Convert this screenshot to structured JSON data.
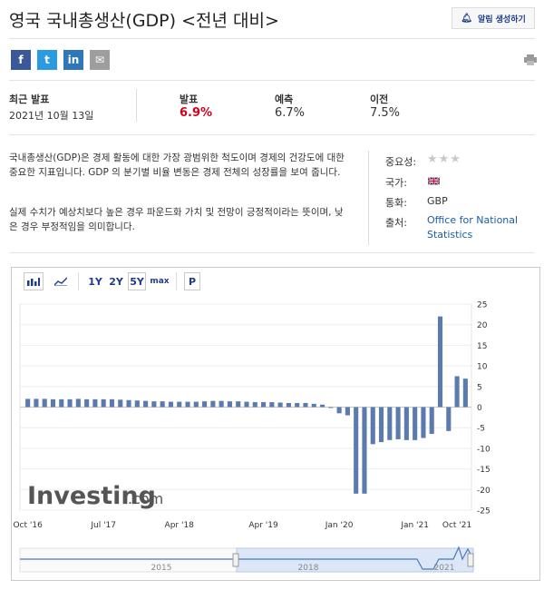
{
  "header": {
    "title": "영국 국내총생산(GDP) <전년 대비>",
    "alert_label": "알림 생성하기"
  },
  "share": [
    {
      "name": "facebook-button",
      "glyph": "f",
      "color": "#3b5998"
    },
    {
      "name": "twitter-button",
      "glyph": "t",
      "color": "#2b9be0"
    },
    {
      "name": "linkedin-button",
      "glyph": "in",
      "color": "#2f77b6"
    },
    {
      "name": "email-button",
      "glyph": "✉",
      "color": "#9e9e9e"
    }
  ],
  "release": {
    "latest_label": "최근 발표",
    "latest_date": "2021년 10월 13일",
    "actual_label": "발표",
    "actual_value": "6.9%",
    "forecast_label": "예측",
    "forecast_value": "6.7%",
    "previous_label": "이전",
    "previous_value": "7.5%",
    "actual_color": "#d0021b"
  },
  "description": {
    "para1": "국내총생산(GDP)은 경제 활동에 대한 가장 광범위한 척도이며 경제의 건강도에 대한 중요한 지표입니다. GDP 의 분기별 비율 변동은 경제 전체의 성장률을 보여 줍니다.",
    "para2": "실제 수치가 예상치보다 높은 경우 파운드화 가치 및 전망이 긍정적이라는 뜻이며, 낮은 경우 부정적임을 의미합니다."
  },
  "info": {
    "importance_label": "중요성:",
    "country_label": "국가:",
    "currency_label": "통화:",
    "currency_value": "GBP",
    "source_label": "출처:",
    "source_line1": "Office for National",
    "source_line2": "Statistics"
  },
  "toolbar": {
    "bar_icon": "bar-chart-icon",
    "line_icon": "line-chart-icon",
    "range_1y": "1Y",
    "range_2y": "2Y",
    "range_5y": "5Y",
    "range_max": "max",
    "p_label": "P"
  },
  "watermark": {
    "brand": "Investing",
    "suffix": ".com"
  },
  "navigator": {
    "labels": [
      "2015",
      "2018",
      "2021"
    ]
  },
  "chart_data": {
    "type": "bar",
    "bar_color": "#5b7ab0",
    "ylim": [
      -25,
      25
    ],
    "yticks": [
      -25,
      -20,
      -15,
      -10,
      -5,
      0,
      5,
      10,
      15,
      20,
      25
    ],
    "x_tick_labels": [
      "Oct '16",
      "Jul '17",
      "Apr '18",
      "Apr '19",
      "Jan '20",
      "Jan '21",
      "Oct '21"
    ],
    "values": [
      2.0,
      2.0,
      2.0,
      1.9,
      1.9,
      1.9,
      2.0,
      1.9,
      1.9,
      1.9,
      1.9,
      1.8,
      1.7,
      1.6,
      1.5,
      1.4,
      1.4,
      1.3,
      1.3,
      1.3,
      1.3,
      1.4,
      1.5,
      1.5,
      1.4,
      1.4,
      1.3,
      1.2,
      1.2,
      1.2,
      1.1,
      1.0,
      1.0,
      1.0,
      0.8,
      0.6,
      0.0,
      -1.5,
      -2.0,
      -21.0,
      -21.0,
      -9.0,
      -8.5,
      -8.0,
      -7.8,
      -8.0,
      -8.0,
      -7.5,
      -6.5,
      22.0,
      -5.8,
      7.5,
      6.9
    ]
  }
}
